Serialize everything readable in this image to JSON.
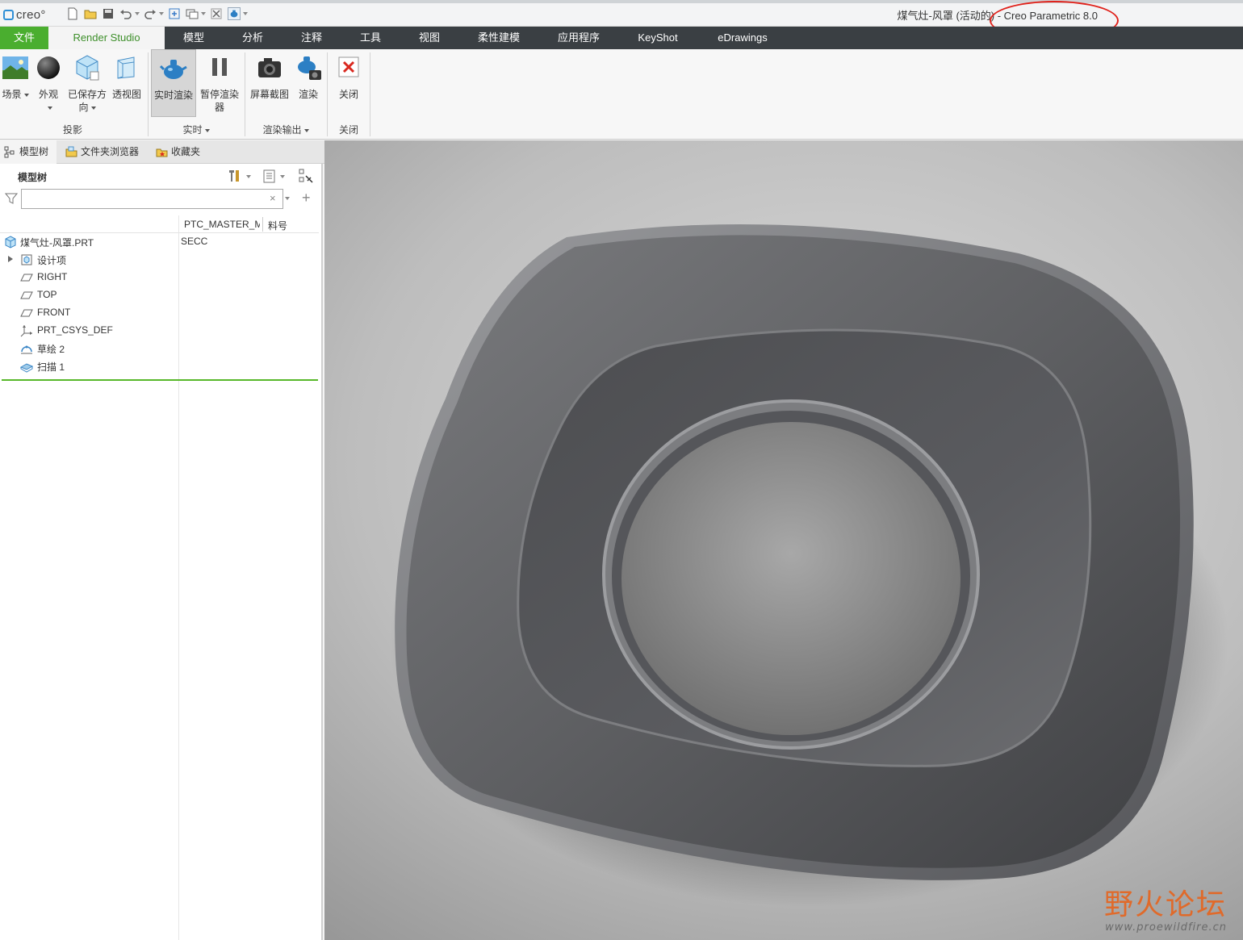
{
  "app": {
    "logo_text": "creo°",
    "window_title": "煤气灶-风罩 (活动的) - Creo Parametric 8.0"
  },
  "tabs": [
    {
      "label": "文件"
    },
    {
      "label": "Render Studio"
    },
    {
      "label": "模型"
    },
    {
      "label": "分析"
    },
    {
      "label": "注释"
    },
    {
      "label": "工具"
    },
    {
      "label": "视图"
    },
    {
      "label": "柔性建模"
    },
    {
      "label": "应用程序"
    },
    {
      "label": "KeyShot"
    },
    {
      "label": "eDrawings"
    }
  ],
  "ribbon": {
    "buttons": [
      {
        "label": "场景",
        "icon": "scene-icon"
      },
      {
        "label": "外观",
        "icon": "appearance-icon"
      },
      {
        "label": "已保存方向",
        "icon": "saved-orientation-icon"
      },
      {
        "label": "透视图",
        "icon": "perspective-icon"
      },
      {
        "label": "实时渲染",
        "icon": "realtime-render-icon"
      },
      {
        "label": "暂停渲染器",
        "icon": "pause-icon"
      },
      {
        "label": "屏幕截图",
        "icon": "camera-icon"
      },
      {
        "label": "渲染",
        "icon": "render-icon"
      },
      {
        "label": "关闭",
        "icon": "close-icon"
      }
    ],
    "groups": [
      {
        "label": "投影"
      },
      {
        "label": "实时"
      },
      {
        "label": "渲染输出"
      },
      {
        "label": "关闭"
      }
    ]
  },
  "panel": {
    "tabs": [
      {
        "label": "模型树"
      },
      {
        "label": "文件夹浏览器"
      },
      {
        "label": "收藏夹"
      }
    ],
    "title": "模型树",
    "search": {
      "value": "",
      "placeholder": ""
    },
    "columns": [
      "PTC_MASTER_M",
      "料号"
    ],
    "tree": [
      {
        "label": "煤气灶-风罩.PRT",
        "value": "SECC",
        "icon": "part-icon"
      },
      {
        "label": "设计项",
        "value": "",
        "icon": "design-items-icon"
      },
      {
        "label": "RIGHT",
        "value": "",
        "icon": "datum-plane-icon"
      },
      {
        "label": "TOP",
        "value": "",
        "icon": "datum-plane-icon"
      },
      {
        "label": "FRONT",
        "value": "",
        "icon": "datum-plane-icon"
      },
      {
        "label": "PRT_CSYS_DEF",
        "value": "",
        "icon": "csys-icon"
      },
      {
        "label": "草绘 2",
        "value": "",
        "icon": "sketch-icon"
      },
      {
        "label": "扫描 1",
        "value": "",
        "icon": "sweep-icon"
      }
    ]
  },
  "watermark": {
    "main": "野火论坛",
    "sub": "www.proewildfire.cn"
  },
  "colors": {
    "file_tab": "#4aae2f",
    "tab_bar": "#3a3f43",
    "highlight_ring": "#e0221b",
    "model_surface": "#5a5b5e"
  }
}
